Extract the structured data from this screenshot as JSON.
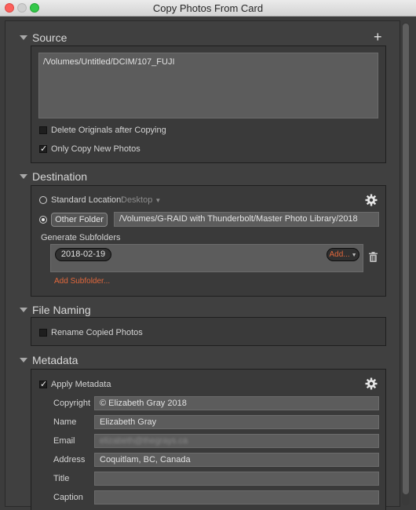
{
  "window": {
    "title": "Copy Photos From Card"
  },
  "source": {
    "header": "Source",
    "path": "/Volumes/Untitled/DCIM/107_FUJI",
    "delete_originals": {
      "label": "Delete Originals after Copying",
      "checked": false
    },
    "only_new": {
      "label": "Only Copy New Photos",
      "checked": true
    }
  },
  "destination": {
    "header": "Destination",
    "standard_location_label": "Standard Location:",
    "standard_location_value": "Desktop",
    "other_folder_button": "Other Folder",
    "other_folder_path": "/Volumes/G-RAID with Thunderbolt/Master Photo Library/2018",
    "selected": "other",
    "generate_subfolders_label": "Generate Subfolders",
    "subfolder_token": "2018-02-19",
    "add_token_button": "Add...",
    "add_subfolder_link": "Add Subfolder...",
    "accent_color": "#e2683c"
  },
  "file_naming": {
    "header": "File Naming",
    "rename": {
      "label": "Rename Copied Photos",
      "checked": false
    }
  },
  "metadata": {
    "header": "Metadata",
    "apply": {
      "label": "Apply Metadata",
      "checked": true
    },
    "fields": {
      "copyright": {
        "label": "Copyright",
        "value": "© Elizabeth Gray 2018"
      },
      "name": {
        "label": "Name",
        "value": "Elizabeth Gray"
      },
      "email": {
        "label": "Email",
        "value": "elizabeth@thegrays.ca"
      },
      "address": {
        "label": "Address",
        "value": "Coquitlam, BC, Canada"
      },
      "title": {
        "label": "Title",
        "value": ""
      },
      "caption": {
        "label": "Caption",
        "value": ""
      }
    }
  },
  "icons": {
    "add": "+",
    "gear": "gear-icon",
    "trash": "trash-icon",
    "disclosure": "triangle-down-icon"
  }
}
